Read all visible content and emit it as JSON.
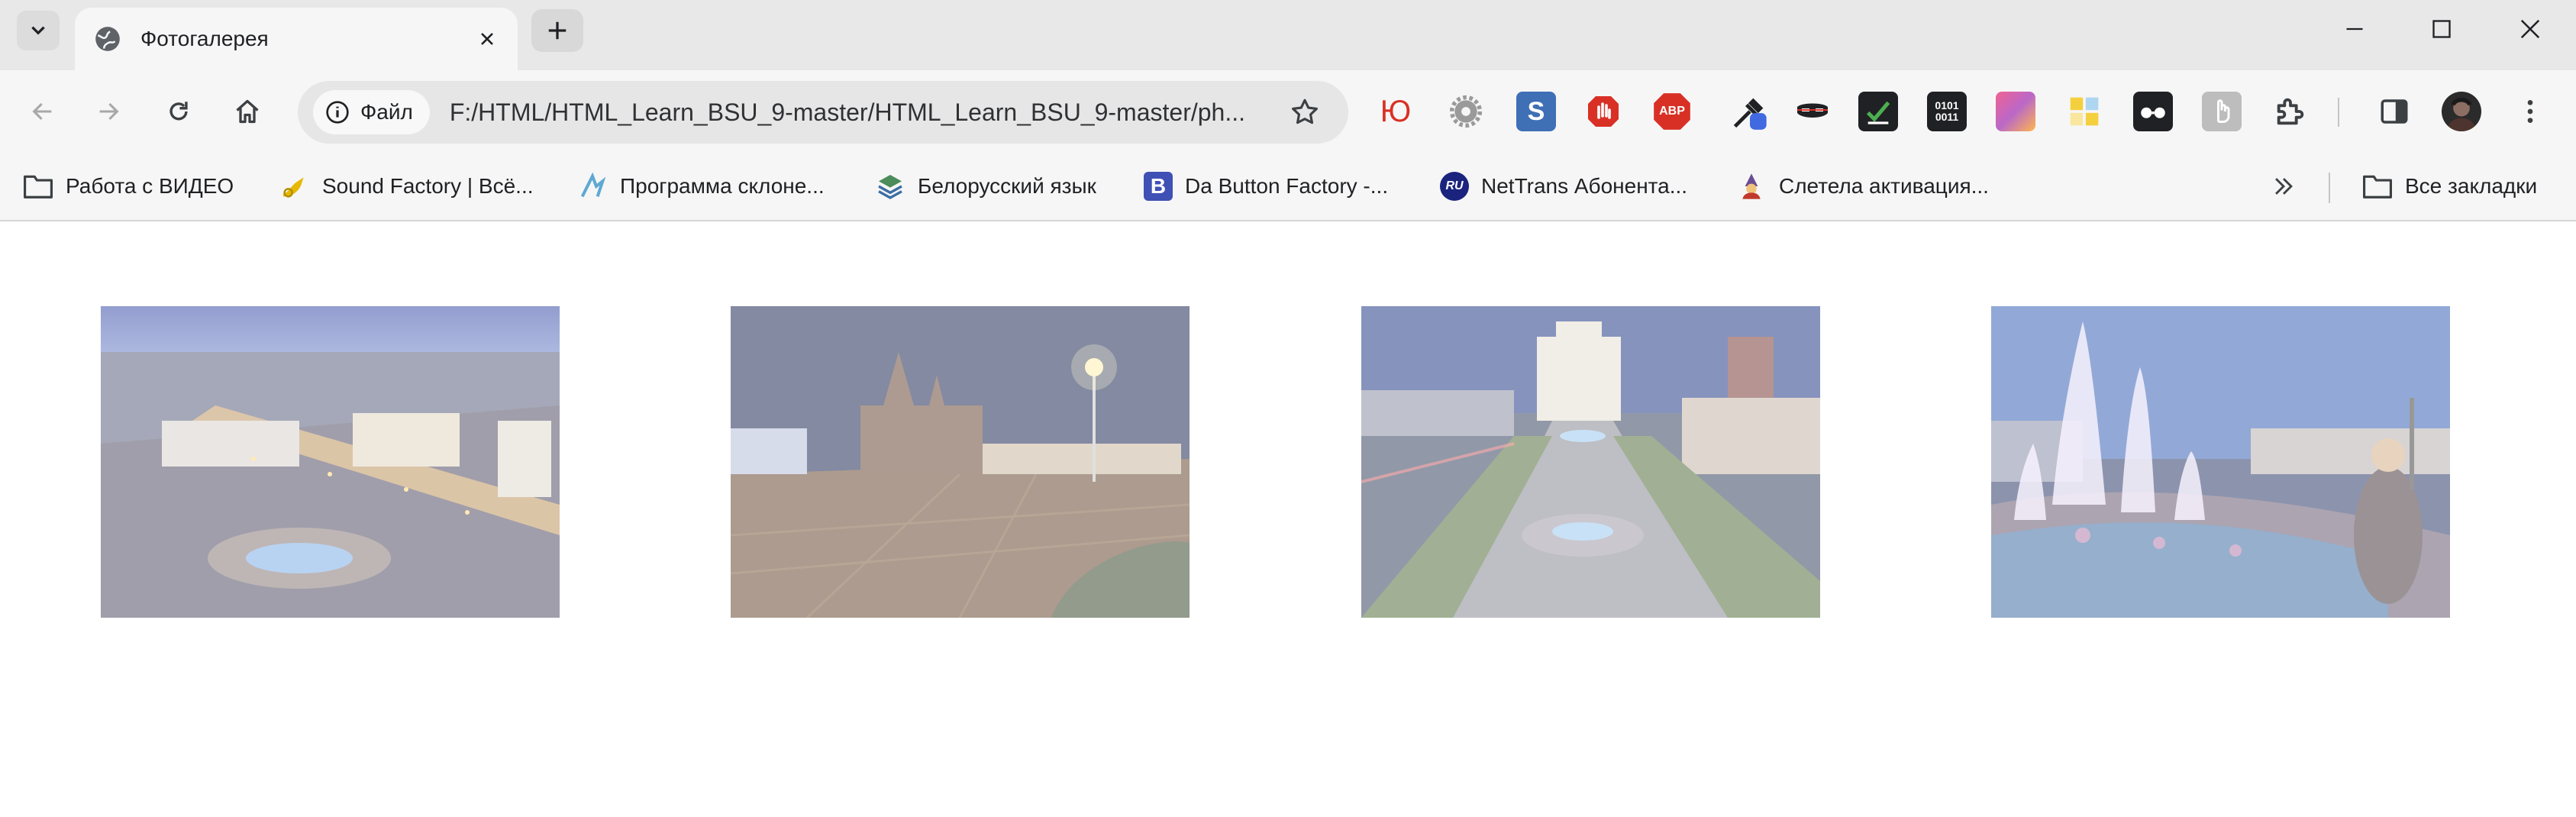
{
  "tab": {
    "title": "Фотогалерея"
  },
  "omnibox": {
    "chip_label": "Файл",
    "url": "F:/HTML/HTML_Learn_BSU_9-master/HTML_Learn_BSU_9-master/ph..."
  },
  "extensions": [
    {
      "icon": "yu-icon",
      "label": "Ю",
      "color": "#d93025"
    },
    {
      "icon": "gear-extension-icon",
      "color": "#7a7a7a"
    },
    {
      "icon": "s-extension-icon",
      "label": "S",
      "color": "#3f6fb5"
    },
    {
      "icon": "stop-hand-icon",
      "color": "#d93025"
    },
    {
      "icon": "adblock-plus-icon",
      "label": "ABP",
      "color": "#d93025"
    },
    {
      "icon": "color-picker-icon",
      "color": "#4169e1"
    },
    {
      "icon": "mask-icon",
      "color": "#202124"
    },
    {
      "icon": "checkmark-board-icon",
      "color": "#202124"
    },
    {
      "icon": "binary-icon",
      "label": "0101 0011",
      "color": "#202124"
    },
    {
      "icon": "gradient-icon",
      "color": "#c050c0"
    },
    {
      "icon": "grid-squares-icon",
      "color": "#e8d040"
    },
    {
      "icon": "glasses-icon",
      "color": "#202124"
    },
    {
      "icon": "image-extension-icon",
      "color": "#9a9a9a"
    },
    {
      "icon": "puzzle-icon",
      "color": "#5f6368"
    }
  ],
  "bookmarks": [
    {
      "icon": "folder-icon",
      "label": "Работа с ВИДЕО"
    },
    {
      "icon": "sound-factory-icon",
      "label": "Sound Factory | Всё..."
    },
    {
      "icon": "program-icon",
      "label": "Программа склоне..."
    },
    {
      "icon": "book-icon",
      "label": "Белорусский язык"
    },
    {
      "icon": "b-icon",
      "label": "Da Button Factory -..."
    },
    {
      "icon": "ru-icon",
      "label": "NetTrans Абонента..."
    },
    {
      "icon": "wizard-icon",
      "label": "Слетела активация..."
    }
  ],
  "all_bookmarks_label": "Все закладки",
  "gallery": {
    "photos": [
      {
        "name": "photo-minsk-panorama"
      },
      {
        "name": "photo-church-square"
      },
      {
        "name": "photo-independence-square"
      },
      {
        "name": "photo-fountain-square"
      }
    ]
  }
}
